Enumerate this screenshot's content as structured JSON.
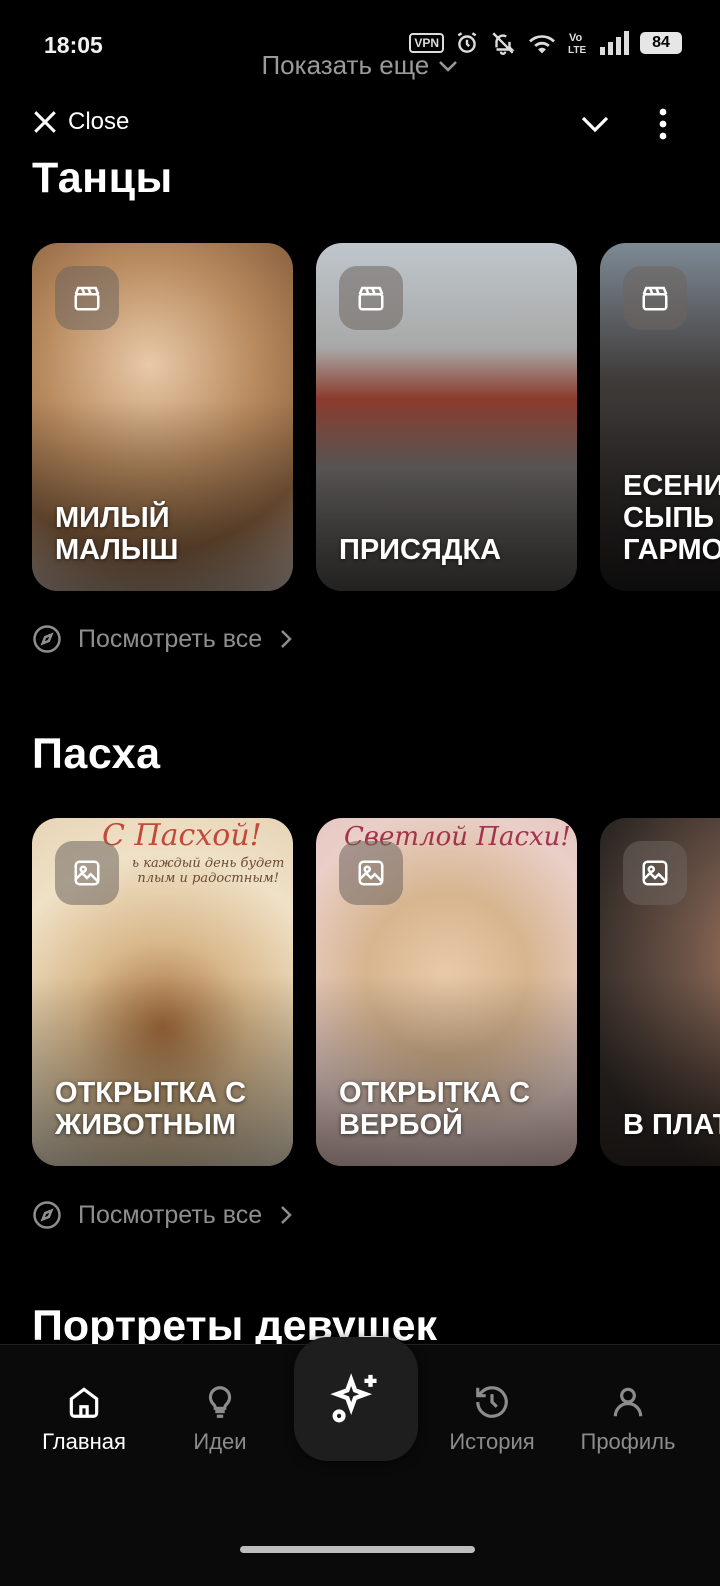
{
  "status_bar": {
    "time": "18:05",
    "vpn": "VPN",
    "lte": "Vo LTE",
    "battery": "84"
  },
  "top": {
    "show_more": "Показать еще",
    "close_label": "Close"
  },
  "sections": [
    {
      "title": "Танцы",
      "cards": [
        {
          "label": "МИЛЫЙ\nМАЛЫШ",
          "icon": "clapperboard-icon"
        },
        {
          "label": "ПРИСЯДКА",
          "icon": "clapperboard-icon"
        },
        {
          "label": "ЕСЕНИН\nСЫПЬ\nГАРМОНЬ",
          "icon": "clapperboard-icon"
        }
      ],
      "see_all": "Посмотреть все"
    },
    {
      "title": "Пасха",
      "cards": [
        {
          "label": "ОТКРЫТКА С\nЖИВОТНЫМ",
          "icon": "image-icon",
          "overlay_text": "С Пасхой!",
          "overlay_sub": "ь каждый день будет\nплым и радостным!"
        },
        {
          "label": "ОТКРЫТКА С\nВЕРБОЙ",
          "icon": "image-icon",
          "overlay_text": "Светлой Пасхи!"
        },
        {
          "label": "В ПЛАТКЕ",
          "icon": "image-icon"
        }
      ],
      "see_all": "Посмотреть все"
    }
  ],
  "next_section_title": "Портреты девушек",
  "bottom_nav": {
    "items": [
      {
        "label": "Главная",
        "icon": "home-icon",
        "active": true
      },
      {
        "label": "Идеи",
        "icon": "lightbulb-icon",
        "active": false
      },
      {
        "label": "",
        "icon": "sparkle-plus-icon",
        "active": false
      },
      {
        "label": "История",
        "icon": "history-icon",
        "active": false
      },
      {
        "label": "Профиль",
        "icon": "profile-icon",
        "active": false
      }
    ]
  }
}
